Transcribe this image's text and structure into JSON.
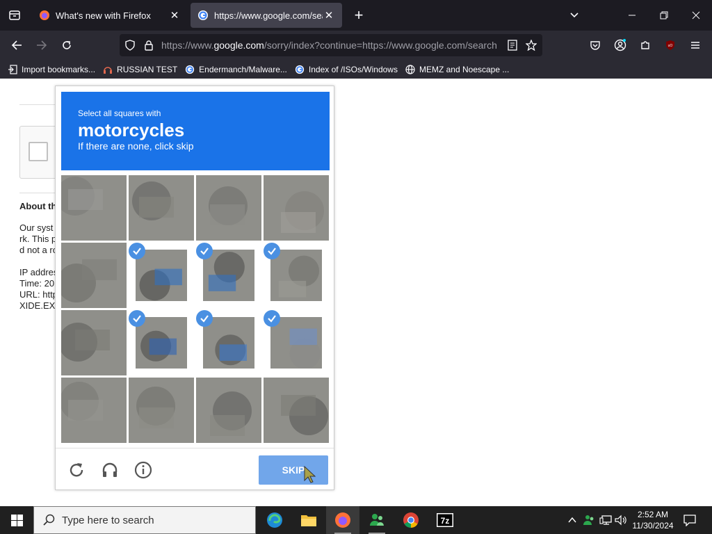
{
  "browser": {
    "tabs": [
      {
        "title": "What's new with Firefox",
        "favicon": "firefox-icon",
        "active": false
      },
      {
        "title": "https://www.google.com/searc",
        "favicon": "google-icon",
        "active": true
      }
    ],
    "url_prefix": "https://www.",
    "url_domain": "google.com",
    "url_rest": "/sorry/index?continue=https://www.google.com/search",
    "bookmarks": [
      {
        "label": "Import bookmarks...",
        "icon": "import-icon"
      },
      {
        "label": "RUSSIAN TEST",
        "icon": "headset-icon"
      },
      {
        "label": "Endermanch/Malware...",
        "icon": "google-icon"
      },
      {
        "label": "Index of /ISOs/Windows",
        "icon": "google-icon"
      },
      {
        "label": "MEMZ and Noescape ...",
        "icon": "globe-icon"
      }
    ]
  },
  "page": {
    "about_heading": "About th",
    "para": [
      "Our syst",
      "rk. This p",
      "d not a ro"
    ],
    "info": [
      "IP addres",
      "Time: 20",
      "URL: http",
      "XIDE.EXE"
    ]
  },
  "captcha": {
    "instruction": "Select all squares with",
    "target": "motorcycles",
    "hint": "If there are none, click skip",
    "selected_cells": [
      5,
      6,
      7,
      9,
      10,
      11
    ],
    "skip_label": "SKIP",
    "accent_color": "#1a73e8"
  },
  "taskbar": {
    "search_placeholder": "Type here to search",
    "time": "2:52 AM",
    "date": "11/30/2024"
  }
}
